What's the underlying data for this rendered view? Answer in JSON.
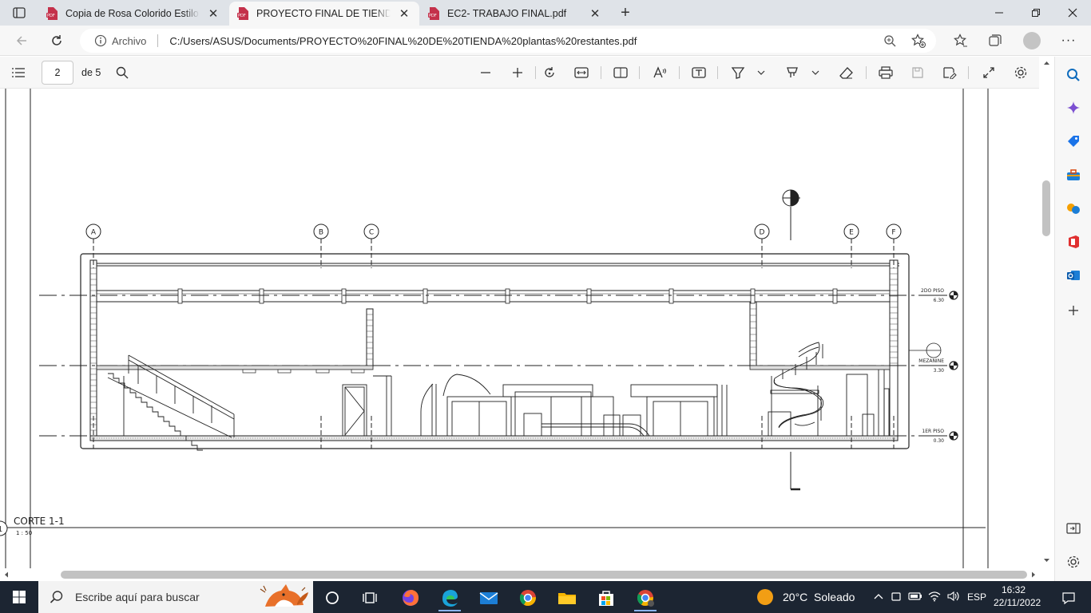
{
  "tabs": [
    {
      "title": "Copia de Rosa Colorido Estilo Se",
      "active": false
    },
    {
      "title": "PROYECTO FINAL DE TIENDA pla",
      "active": true
    },
    {
      "title": "EC2- TRABAJO FINAL.pdf",
      "active": false
    }
  ],
  "address": {
    "scheme_label": "Archivo",
    "url": "C:/Users/ASUS/Documents/PROYECTO%20FINAL%20DE%20TIENDA%20plantas%20restantes.pdf"
  },
  "pdf_toolbar": {
    "page_number": "2",
    "page_of": "de 5"
  },
  "drawing": {
    "axes": [
      "A",
      "B",
      "C",
      "D",
      "E",
      "F"
    ],
    "levels": [
      {
        "name": "2DO PISO",
        "value": "6.30"
      },
      {
        "name": "MEZANINE",
        "value": "3.30"
      },
      {
        "name": "1ER PISO",
        "value": "0.30"
      }
    ],
    "section_title": "CORTE 1-1",
    "scale": "1 : 50",
    "section_number": "1"
  },
  "taskbar": {
    "search_placeholder": "Escribe aquí para buscar",
    "weather": "20°C  Soleado",
    "language": "ESP",
    "time": "16:32",
    "date": "22/11/2022"
  },
  "colors": {
    "accent": "#0f6cbd",
    "taskbar": "#1c2532",
    "pdf_red": "#c4314b"
  }
}
